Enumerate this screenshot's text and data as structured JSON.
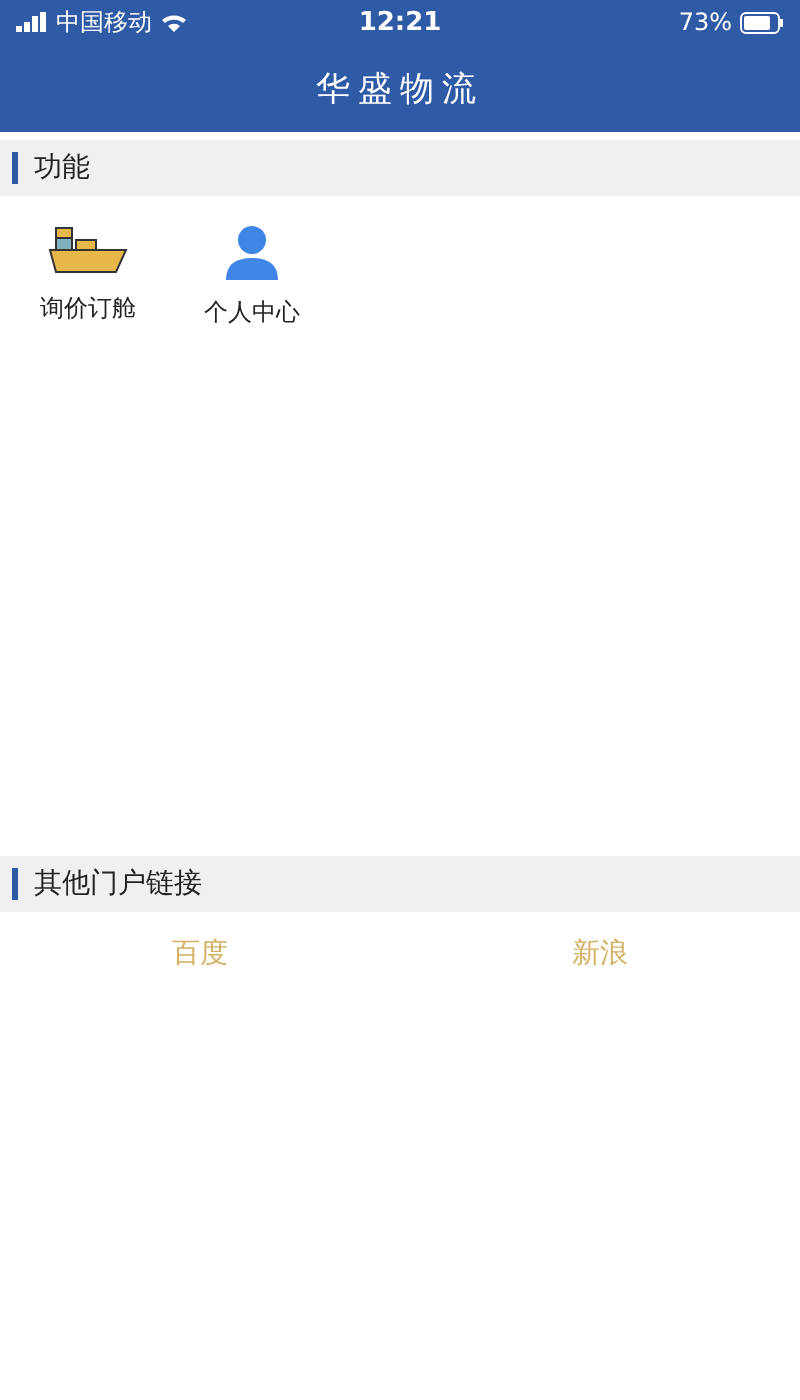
{
  "status_bar": {
    "carrier": "中国移动",
    "time": "12:21",
    "battery": "73%"
  },
  "nav": {
    "title": "华盛物流"
  },
  "sections": [
    {
      "title": "功能",
      "features": [
        {
          "kind": "ship",
          "label": "询价订舱"
        },
        {
          "kind": "person",
          "label": "个人中心"
        }
      ]
    },
    {
      "title": "其他门户链接",
      "links": [
        "百度",
        "新浪"
      ]
    }
  ]
}
